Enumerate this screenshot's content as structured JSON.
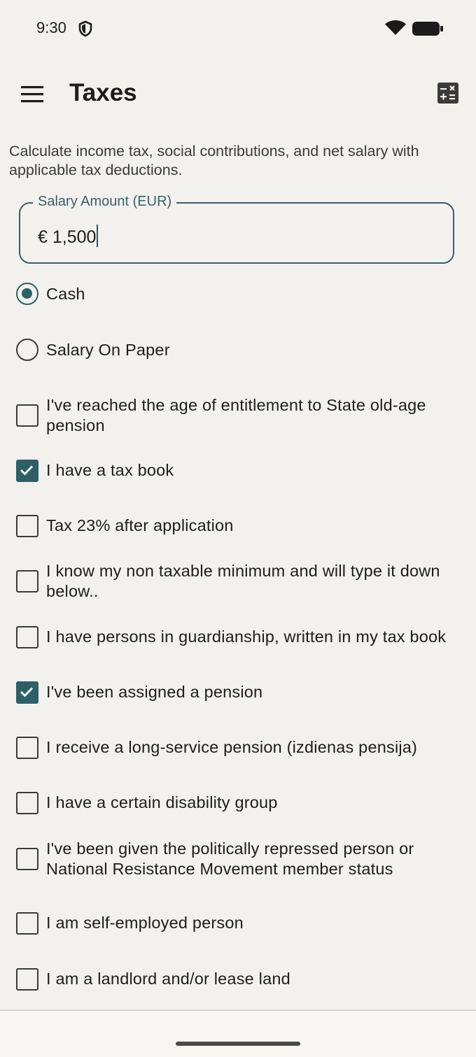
{
  "status_bar": {
    "time": "9:30",
    "icons": [
      "shield-icon",
      "wifi-icon",
      "battery-icon"
    ]
  },
  "app_bar": {
    "title": "Taxes",
    "left_icon": "menu-icon",
    "right_icon": "calculator-icon"
  },
  "description": "Calculate income tax, social contributions, and net salary with applicable tax deductions.",
  "salary_field": {
    "label": "Salary Amount (EUR)",
    "value": "€ 1,500"
  },
  "payment_type": [
    {
      "label": "Cash",
      "selected": true
    },
    {
      "label": "Salary On Paper",
      "selected": false
    }
  ],
  "checkboxes": [
    {
      "label": "I've reached the age of entitlement to State old-age pension",
      "checked": false
    },
    {
      "label": "I have a tax book",
      "checked": true
    },
    {
      "label": "Tax 23% after application",
      "checked": false
    },
    {
      "label": "I know my non taxable minimum and will type it down below..",
      "checked": false
    },
    {
      "label": "I have persons in guardianship, written in my tax book",
      "checked": false
    },
    {
      "label": "I've been assigned a pension",
      "checked": true
    },
    {
      "label": "I receive a long-service pension (izdienas pensija)",
      "checked": false
    },
    {
      "label": "I have a certain disability group",
      "checked": false
    },
    {
      "label": "I've been given the politically repressed person or National Resistance Movement member status",
      "checked": false
    },
    {
      "label": "I am self-employed person",
      "checked": false
    },
    {
      "label": "I am a landlord and/or lease land",
      "checked": false
    }
  ],
  "colors": {
    "accent": "#2e5f67",
    "background": "#f2f1ee"
  }
}
